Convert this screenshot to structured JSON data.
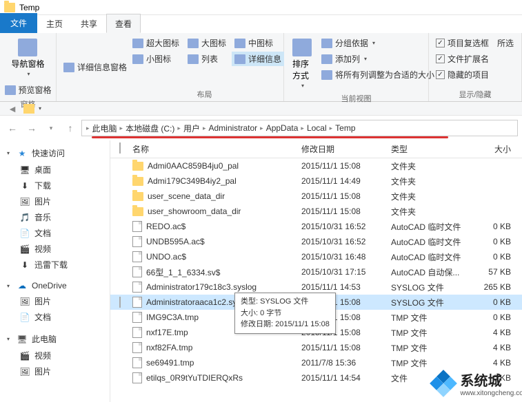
{
  "title": "Temp",
  "tabs": {
    "file": "文件",
    "home": "主页",
    "share": "共享",
    "view": "查看"
  },
  "ribbon": {
    "pane": {
      "nav": "导航窗格",
      "detail": "详细信息窗格",
      "preview": "预览窗格",
      "label": "窗格"
    },
    "layout": {
      "xl": "超大图标",
      "l": "大图标",
      "m": "中图标",
      "s": "小图标",
      "list": "列表",
      "detail": "详细信息",
      "label": "布局"
    },
    "current": {
      "sort": "排序方式",
      "group": "分组依据",
      "addcol": "添加列",
      "fit": "将所有列调整为合适的大小",
      "label": "当前视图"
    },
    "showhide": {
      "check": "项目复选框",
      "ext": "文件扩展名",
      "hidden": "隐藏的项目",
      "hidesel": "所选",
      "label": "显示/隐藏"
    }
  },
  "breadcrumb": [
    "此电脑",
    "本地磁盘 (C:)",
    "用户",
    "Administrator",
    "AppData",
    "Local",
    "Temp"
  ],
  "sidebar": {
    "quick": {
      "label": "快速访问",
      "items": [
        "桌面",
        "下载",
        "图片",
        "音乐",
        "文档",
        "视频",
        "迅雷下载"
      ]
    },
    "onedrive": {
      "label": "OneDrive",
      "items": [
        "图片",
        "文档"
      ]
    },
    "thispc": {
      "label": "此电脑",
      "items": [
        "视频",
        "图片"
      ]
    }
  },
  "columns": {
    "name": "名称",
    "date": "修改日期",
    "type": "类型",
    "size": "大小"
  },
  "files": [
    {
      "icon": "folder",
      "name": "Admi0AAC859B4ju0_pal",
      "date": "2015/11/1 15:08",
      "type": "文件夹",
      "size": ""
    },
    {
      "icon": "folder",
      "name": "Admi179C349B4iy2_pal",
      "date": "2015/11/1 14:49",
      "type": "文件夹",
      "size": ""
    },
    {
      "icon": "folder",
      "name": "user_scene_data_dir",
      "date": "2015/11/1 15:08",
      "type": "文件夹",
      "size": ""
    },
    {
      "icon": "folder",
      "name": "user_showroom_data_dir",
      "date": "2015/11/1 15:08",
      "type": "文件夹",
      "size": ""
    },
    {
      "icon": "file",
      "name": "REDO.ac$",
      "date": "2015/10/31 16:52",
      "type": "AutoCAD 临时文件",
      "size": "0 KB"
    },
    {
      "icon": "file",
      "name": "UNDB595A.ac$",
      "date": "2015/10/31 16:52",
      "type": "AutoCAD 临时文件",
      "size": "0 KB"
    },
    {
      "icon": "file",
      "name": "UNDO.ac$",
      "date": "2015/10/31 16:48",
      "type": "AutoCAD 临时文件",
      "size": "0 KB"
    },
    {
      "icon": "file",
      "name": "66型_1_1_6334.sv$",
      "date": "2015/10/31 17:15",
      "type": "AutoCAD 自动保...",
      "size": "57 KB"
    },
    {
      "icon": "file",
      "name": "Administrator179c18c3.syslog",
      "date": "2015/11/1 14:53",
      "type": "SYSLOG 文件",
      "size": "265 KB"
    },
    {
      "icon": "file",
      "name": "Administratoraaca1c2.syslog",
      "date": "2015/11/1 15:08",
      "type": "SYSLOG 文件",
      "size": "0 KB",
      "selected": true
    },
    {
      "icon": "file",
      "name": "IMG9C3A.tmp",
      "date": "2015/11/1 15:08",
      "type": "TMP 文件",
      "size": "0 KB"
    },
    {
      "icon": "file",
      "name": "nxf17E.tmp",
      "date": "2015/11/1 15:08",
      "type": "TMP 文件",
      "size": "4 KB"
    },
    {
      "icon": "file",
      "name": "nxf82FA.tmp",
      "date": "2015/11/1 15:08",
      "type": "TMP 文件",
      "size": "4 KB"
    },
    {
      "icon": "file",
      "name": "se69491.tmp",
      "date": "2011/7/8 15:36",
      "type": "TMP 文件",
      "size": "4 KB"
    },
    {
      "icon": "file",
      "name": "etilqs_0R9tYuTDIERQxRs",
      "date": "2015/11/1 14:54",
      "type": "文件",
      "size": "0 KB"
    }
  ],
  "tooltip": {
    "l1": "类型: SYSLOG 文件",
    "l2": "大小: 0 字节",
    "l3": "修改日期: 2015/11/1 15:08"
  },
  "watermark": {
    "name": "系统城",
    "sub": "www.xitongcheng.com"
  }
}
